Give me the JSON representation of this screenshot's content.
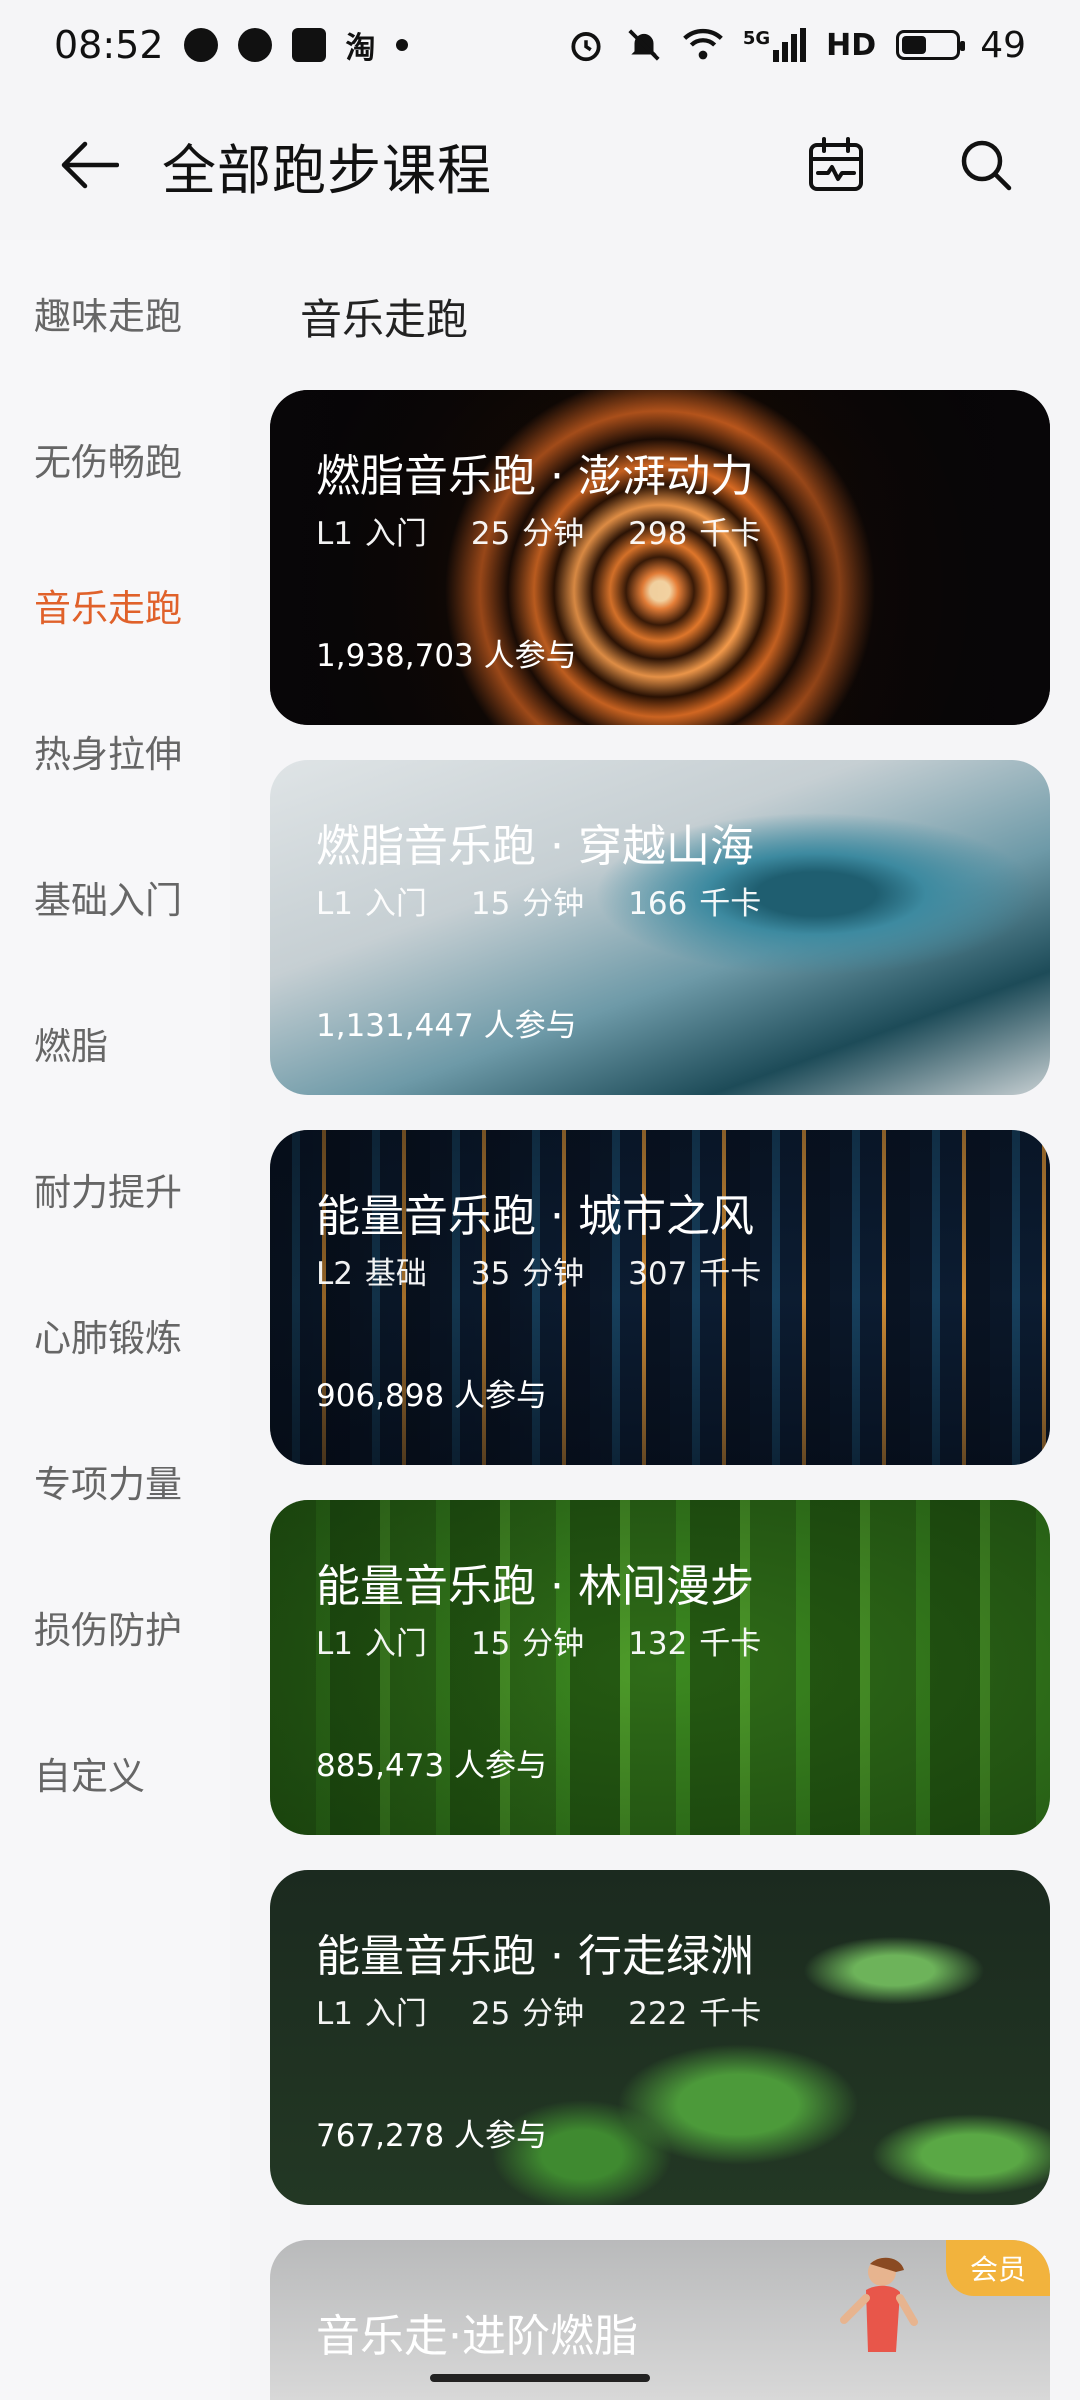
{
  "status_bar": {
    "time": "08:52",
    "app_icons": [
      "bubble-icon",
      "chat-icon",
      "tiktok-icon",
      "taobao-icon"
    ],
    "taobao_label": "淘",
    "signal_label": "5G",
    "hd_label": "HD",
    "battery_level": 49,
    "battery_label": "49"
  },
  "header": {
    "title": "全部跑步课程"
  },
  "sidebar": {
    "items": [
      {
        "label": "趣味走跑"
      },
      {
        "label": "无伤畅跑"
      },
      {
        "label": "音乐走跑",
        "active": true
      },
      {
        "label": "热身拉伸"
      },
      {
        "label": "基础入门"
      },
      {
        "label": "燃脂"
      },
      {
        "label": "耐力提升"
      },
      {
        "label": "心肺锻炼"
      },
      {
        "label": "专项力量"
      },
      {
        "label": "损伤防护"
      },
      {
        "label": "自定义"
      }
    ]
  },
  "main": {
    "section_title": "音乐走跑",
    "cards": [
      {
        "title": "燃脂音乐跑 · 澎湃动力",
        "level": "L1 入门",
        "duration": "25 分钟",
        "calories": "298 千卡",
        "participants": "1,938,703 人参与"
      },
      {
        "title": "燃脂音乐跑 · 穿越山海",
        "level": "L1 入门",
        "duration": "15 分钟",
        "calories": "166 千卡",
        "participants": "1,131,447 人参与"
      },
      {
        "title": "能量音乐跑 · 城市之风",
        "level": "L2 基础",
        "duration": "35 分钟",
        "calories": "307 千卡",
        "participants": "906,898 人参与"
      },
      {
        "title": "能量音乐跑 · 林间漫步",
        "level": "L1 入门",
        "duration": "15 分钟",
        "calories": "132 千卡",
        "participants": "885,473 人参与"
      },
      {
        "title": "能量音乐跑 · 行走绿洲",
        "level": "L1 入门",
        "duration": "25 分钟",
        "calories": "222 千卡",
        "participants": "767,278 人参与"
      },
      {
        "title": "音乐走·进阶燃脂",
        "badge": "会员"
      }
    ]
  },
  "colors": {
    "accent": "#e0612a",
    "badge": "#f2b33d"
  }
}
